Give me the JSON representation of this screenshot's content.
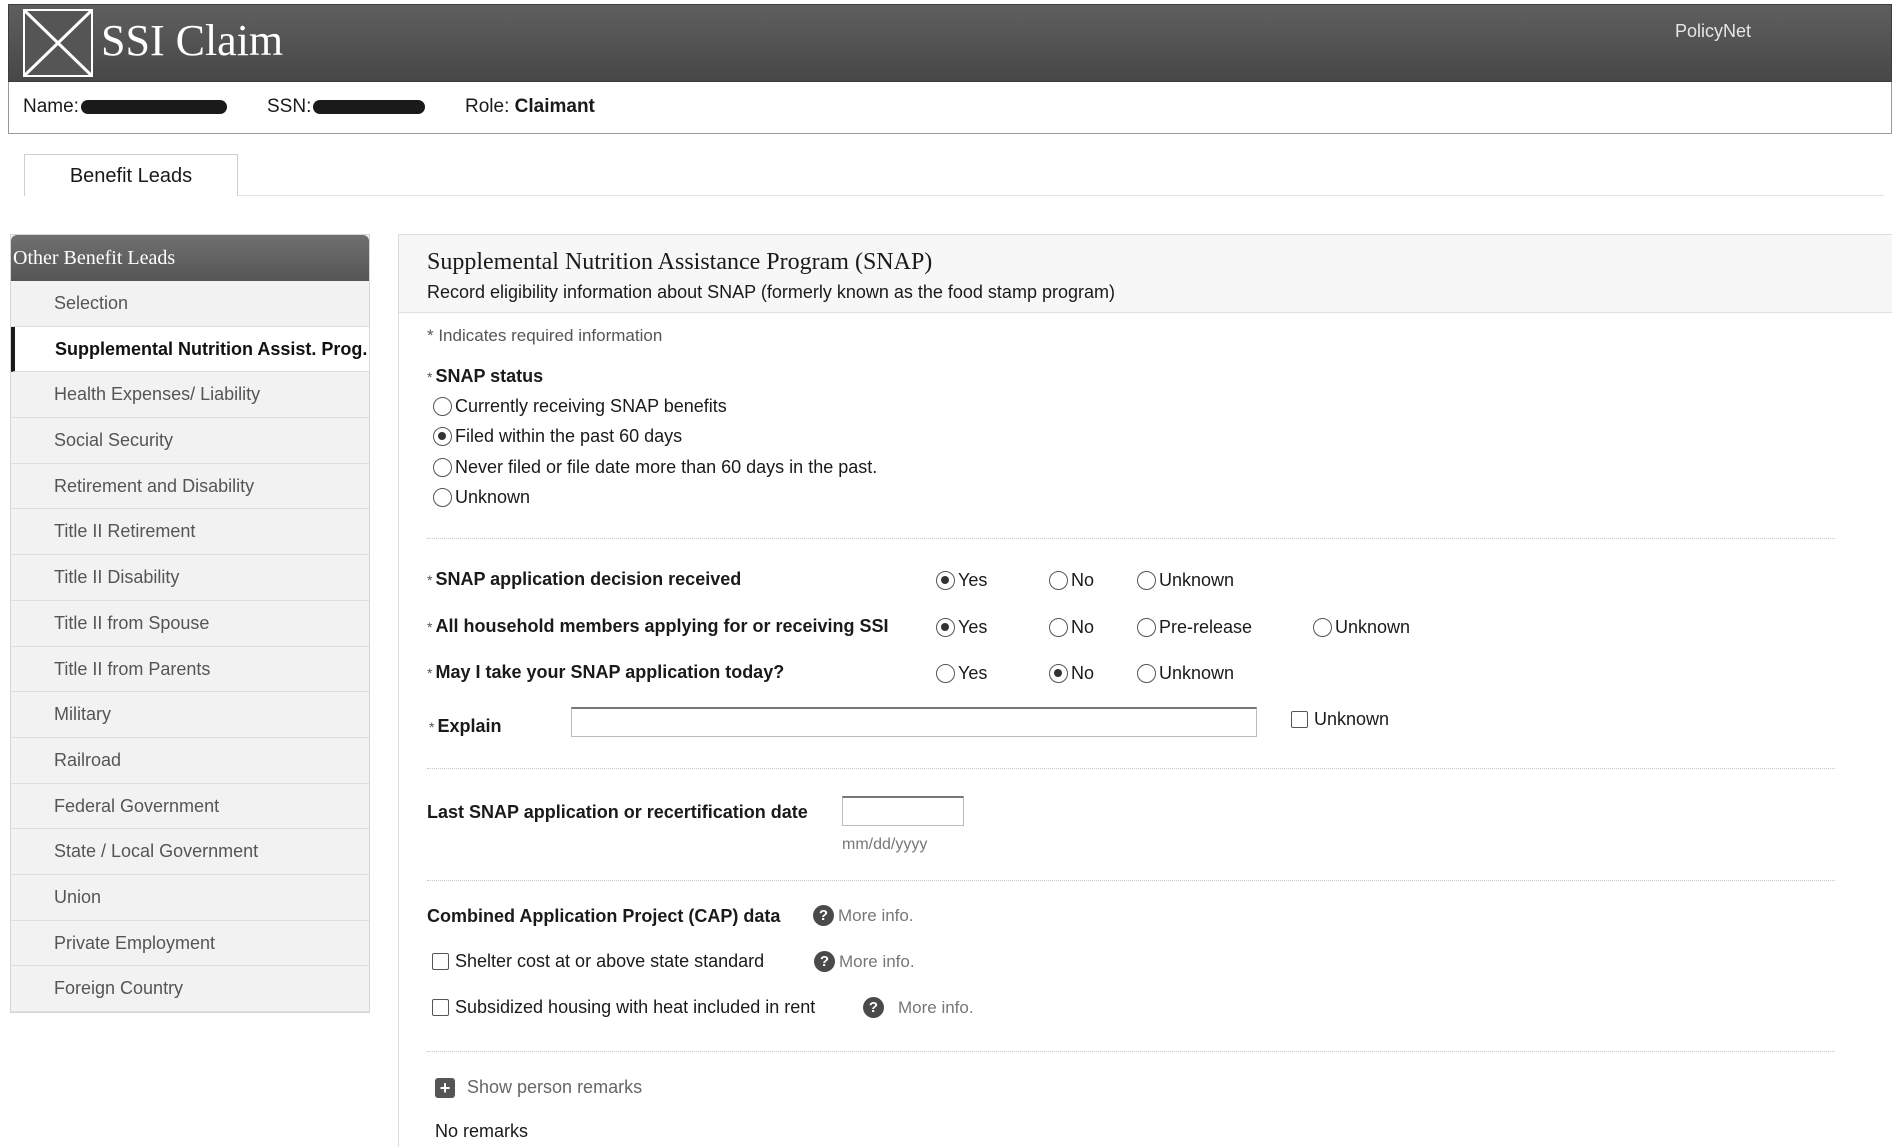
{
  "app": {
    "title": "SSI Claim",
    "policynet_label": "PolicyNet"
  },
  "user_bar": {
    "name_label": "Name:",
    "ssn_label": "SSN:",
    "role_label": "Role:",
    "role_value": "Claimant"
  },
  "tabs": [
    {
      "label": "Benefit Leads"
    }
  ],
  "sidebar": {
    "header": "Other Benefit Leads",
    "items": [
      {
        "label": "Selection"
      },
      {
        "label": "Supplemental Nutrition Assist. Prog."
      },
      {
        "label": "Health Expenses/ Liability"
      },
      {
        "label": "Social Security"
      },
      {
        "label": "Retirement and Disability"
      },
      {
        "label": "Title II Retirement"
      },
      {
        "label": "Title II Disability"
      },
      {
        "label": "Title II from Spouse"
      },
      {
        "label": "Title II from Parents"
      },
      {
        "label": "Military"
      },
      {
        "label": "Railroad"
      },
      {
        "label": "Federal Government"
      },
      {
        "label": "State / Local Government"
      },
      {
        "label": "Union"
      },
      {
        "label": "Private Employment"
      },
      {
        "label": "Foreign Country"
      }
    ],
    "active_index": 1
  },
  "main": {
    "title": "Supplemental Nutrition Assistance Program (SNAP)",
    "subtitle": "Record eligibility information about SNAP (formerly known as the food stamp program)",
    "required_note": "* Indicates required information",
    "snap_status": {
      "label": "SNAP status",
      "options": [
        "Currently receiving SNAP benefits",
        "Filed within the past 60 days",
        "Never filed or file date more than 60 days in the past.",
        "Unknown"
      ],
      "selected": "Filed within the past 60 days"
    },
    "decision_received": {
      "label": "SNAP application decision received",
      "options": [
        "Yes",
        "No",
        "Unknown"
      ],
      "selected": "Yes"
    },
    "household_members": {
      "label": "All household members applying for or receiving SSI",
      "options": [
        "Yes",
        "No",
        "Pre-release",
        "Unknown"
      ],
      "selected": "Yes"
    },
    "take_application": {
      "label": "May I take your SNAP application today?",
      "options": [
        "Yes",
        "No",
        "Unknown"
      ],
      "selected": "No"
    },
    "explain": {
      "label": "Explain",
      "value": "",
      "unknown_label": "Unknown",
      "unknown_checked": false
    },
    "last_date": {
      "label": "Last SNAP application or recertification date",
      "value": "",
      "format_hint": "mm/dd/yyyy"
    },
    "cap": {
      "label": "Combined Application Project (CAP) data",
      "more_info": "More info.",
      "shelter": {
        "label": "Shelter cost at or above state standard",
        "checked": false
      },
      "subsidized": {
        "label": "Subsidized housing with heat included in rent",
        "checked": false
      }
    },
    "remarks": {
      "toggle_label": "Show person remarks",
      "value": "No remarks"
    }
  }
}
